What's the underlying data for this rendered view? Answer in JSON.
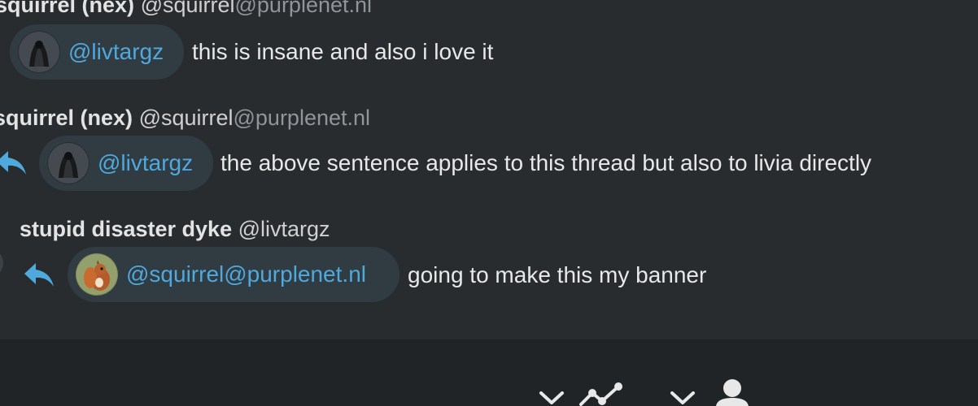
{
  "posts": [
    {
      "author_name": "squirrel (nex)",
      "author_handle": "@squirrel",
      "author_domain": "@purplenet.nl",
      "mention_label": "@livtargz",
      "text": "this is insane and also i love it"
    },
    {
      "author_name": "squirrel (nex)",
      "author_handle": "@squirrel",
      "author_domain": "@purplenet.nl",
      "mention_label": "@livtargz",
      "text": "the above sentence applies to this thread but also to livia directly"
    },
    {
      "author_name": "stupid disaster dyke",
      "author_handle": "@livtargz",
      "mention_label": "@squirrel@purplenet.nl",
      "text": "going to make this my banner"
    }
  ],
  "icons": {
    "reply": "reply-icon",
    "chevron": "chevron-down-icon",
    "trend": "trend-icon",
    "user": "user-icon"
  },
  "colors": {
    "background": "#282c2f",
    "mention_bg": "#313b42",
    "mention_text": "#4fa9dc",
    "reply_icon": "#4fa9dc",
    "bottom_bar": "#202426"
  }
}
